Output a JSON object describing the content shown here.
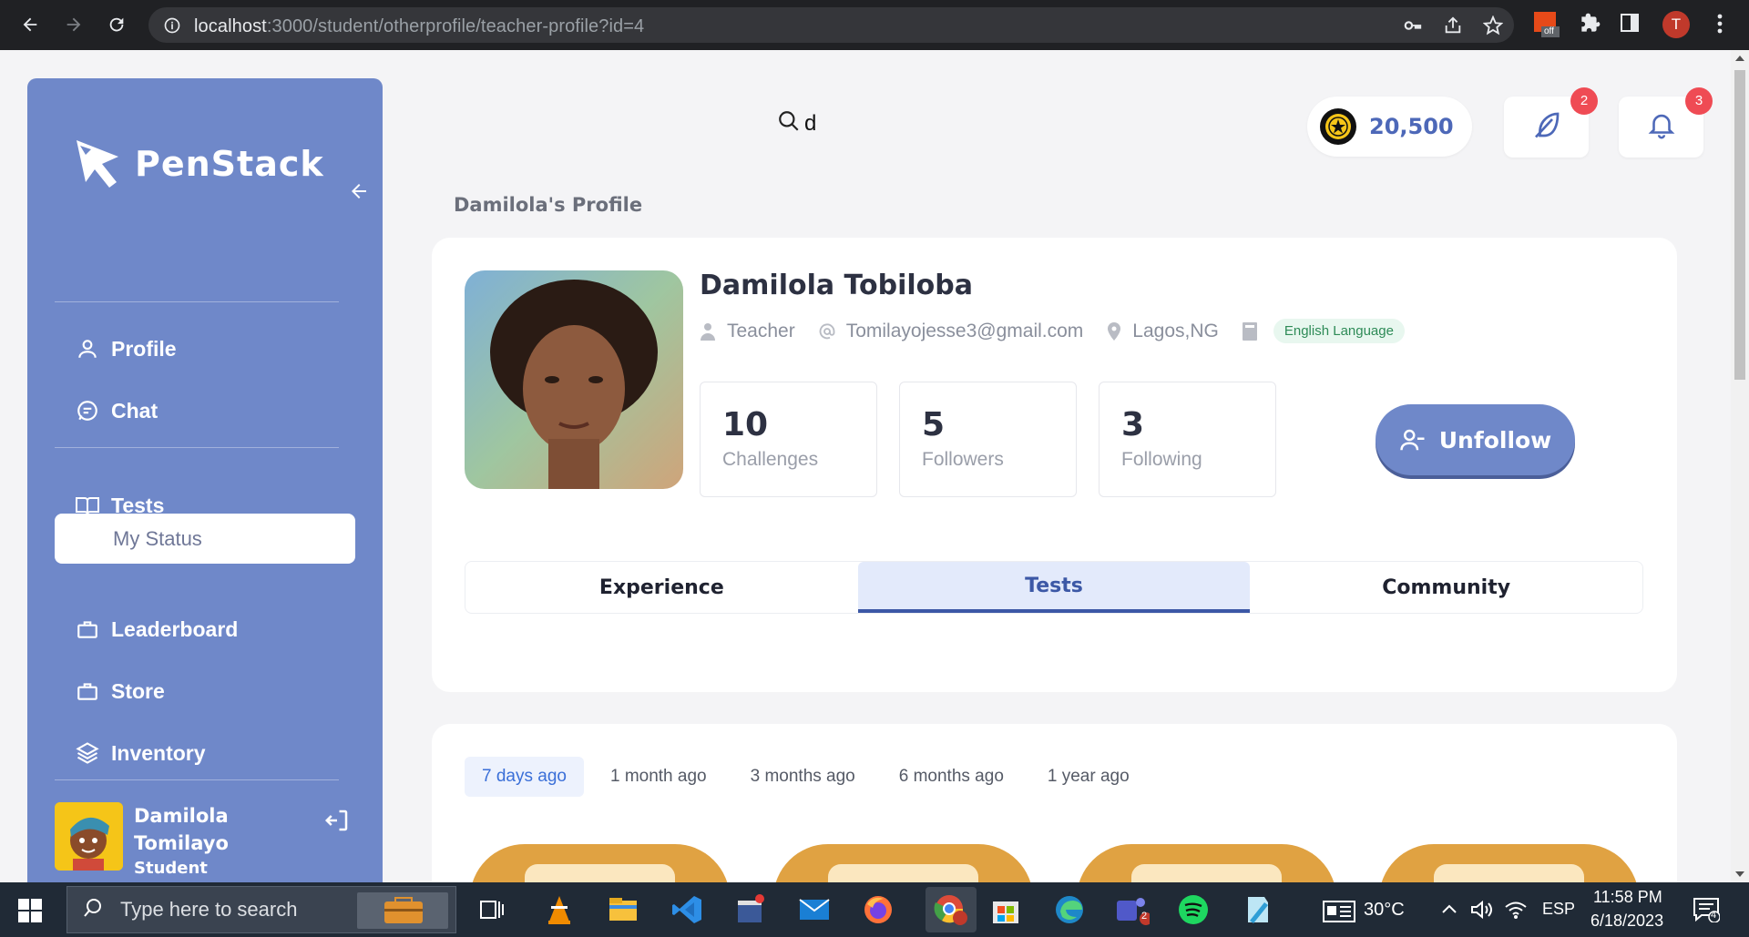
{
  "browser": {
    "url_host": "localhost",
    "url_rest": ":3000/student/otherprofile/teacher-profile?id=4",
    "profile_initial": "T",
    "ext_badge": "off"
  },
  "sidebar": {
    "logo": "PenStack",
    "items": [
      {
        "label": "Profile",
        "icon": "user-icon"
      },
      {
        "label": "Chat",
        "icon": "chat-icon"
      },
      {
        "label": "Tests",
        "icon": "book-icon"
      },
      {
        "label": "Leaderboard",
        "icon": "briefcase-icon"
      },
      {
        "label": "Store",
        "icon": "briefcase-icon"
      },
      {
        "label": "Inventory",
        "icon": "layers-icon"
      }
    ],
    "sub_item": "My Status",
    "user": {
      "first": "Damilola",
      "last": "Tomilayo",
      "role": "Student"
    }
  },
  "topbar": {
    "search_value": "d",
    "coins": "20,500",
    "messages_badge": "2",
    "notifications_badge": "3"
  },
  "page_title": "Damilola's Profile",
  "profile": {
    "name": "Damilola Tobiloba",
    "role": "Teacher",
    "email": "Tomilayojesse3@gmail.com",
    "location": "Lagos,NG",
    "subject": "English Language",
    "stats": [
      {
        "value": "10",
        "label": "Challenges"
      },
      {
        "value": "5",
        "label": "Followers"
      },
      {
        "value": "3",
        "label": "Following"
      }
    ],
    "action": "Unfollow",
    "tabs": [
      "Experience",
      "Tests",
      "Community"
    ],
    "active_tab": "Tests"
  },
  "tests": {
    "filters": [
      "7 days ago",
      "1 month ago",
      "3 months ago",
      "6 months ago",
      "1 year ago"
    ],
    "active_filter": "7 days ago"
  },
  "taskbar": {
    "search_placeholder": "Type here to search",
    "weather": "30°C",
    "lang": "ESP",
    "time": "11:58 PM",
    "date": "6/18/2023",
    "notif_count": "4",
    "teams_badge": "2"
  },
  "colors": {
    "sidebar": "#6f88c9",
    "accent": "#3c58a6",
    "badge": "#ef4b54",
    "coin_text": "#4d68b8"
  }
}
